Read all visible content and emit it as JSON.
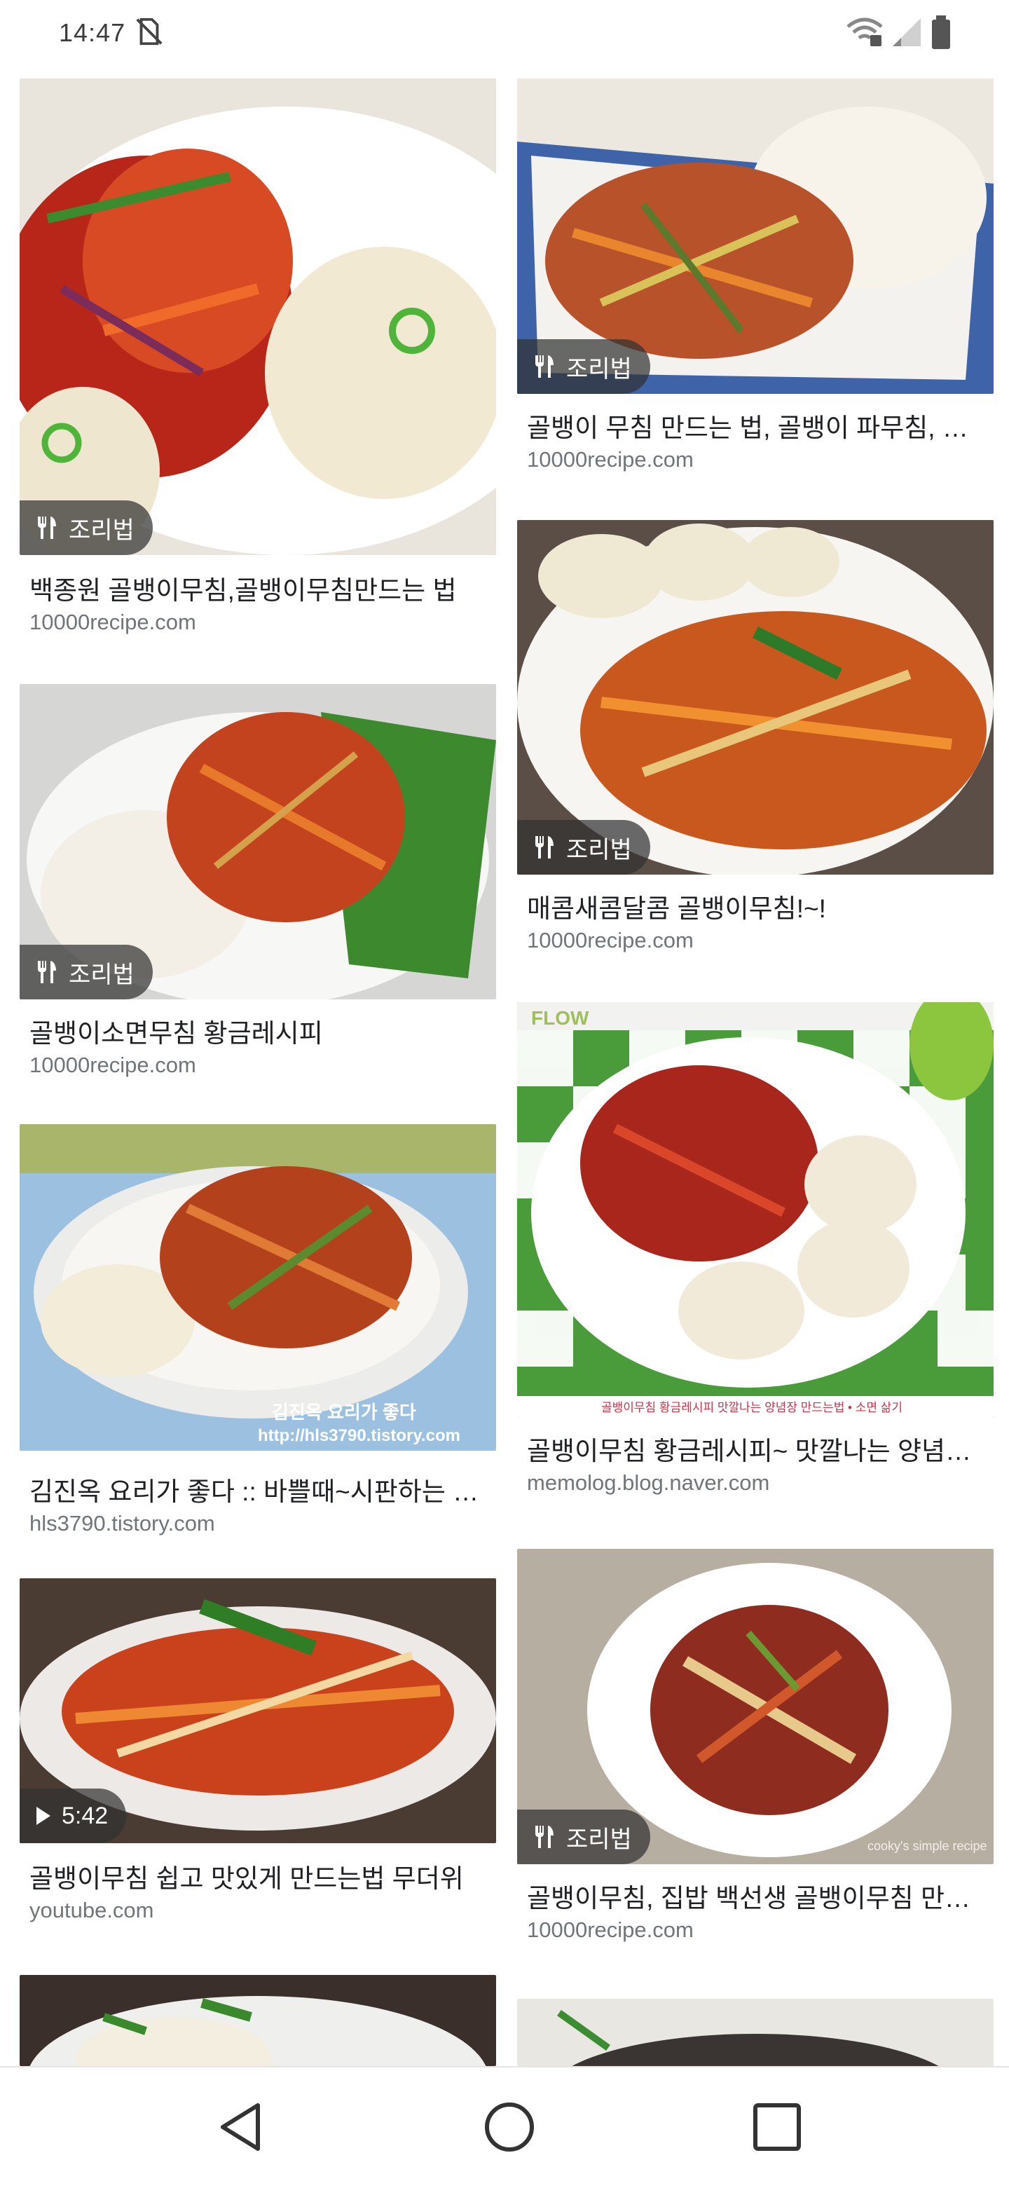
{
  "status_bar": {
    "time": "14:47"
  },
  "badge_recipe_label": "조리법",
  "results": [
    {
      "title": "백종원 골뱅이무침,골뱅이무침만드는 법",
      "domain": "10000recipe.com",
      "badge": "조리법"
    },
    {
      "title": "골뱅이 무침 만드는 법, 골뱅이 파무침, 소면",
      "domain": "10000recipe.com",
      "badge": "조리법"
    },
    {
      "title": "골뱅이소면무침 황금레시피",
      "domain": "10000recipe.com",
      "badge": "조리법"
    },
    {
      "title": "매콤새콤달콤 골뱅이무침!~!",
      "domain": "10000recipe.com",
      "badge": "조리법"
    },
    {
      "title": "김진옥 요리가 좋다 :: 바쁠때~시판하는 골뱅이",
      "domain": "hls3790.tistory.com",
      "watermark_line1": "김진옥 요리가 좋다",
      "watermark_line2": "http://hls3790.tistory.com"
    },
    {
      "title": "골뱅이무침 황금레시피~ 맛깔나는 양념장 만드는 법",
      "domain": "memolog.blog.naver.com",
      "caption": "골뱅이무침 황금레시피 맛깔나는 양념장 만드는법 • 소면 삶기",
      "watermark": "FLOW"
    },
    {
      "title": "골뱅이무침 쉽고 맛있게 만드는법 무더위",
      "domain": "youtube.com",
      "duration": "5:42"
    },
    {
      "title": "골뱅이무침, 집밥 백선생 골뱅이무침 만들기",
      "domain": "10000recipe.com",
      "badge": "조리법",
      "watermark": "cooky's simple recipe"
    }
  ],
  "colors": {
    "badge_bg": "#323232",
    "title": "#202124",
    "domain": "#70757a"
  }
}
